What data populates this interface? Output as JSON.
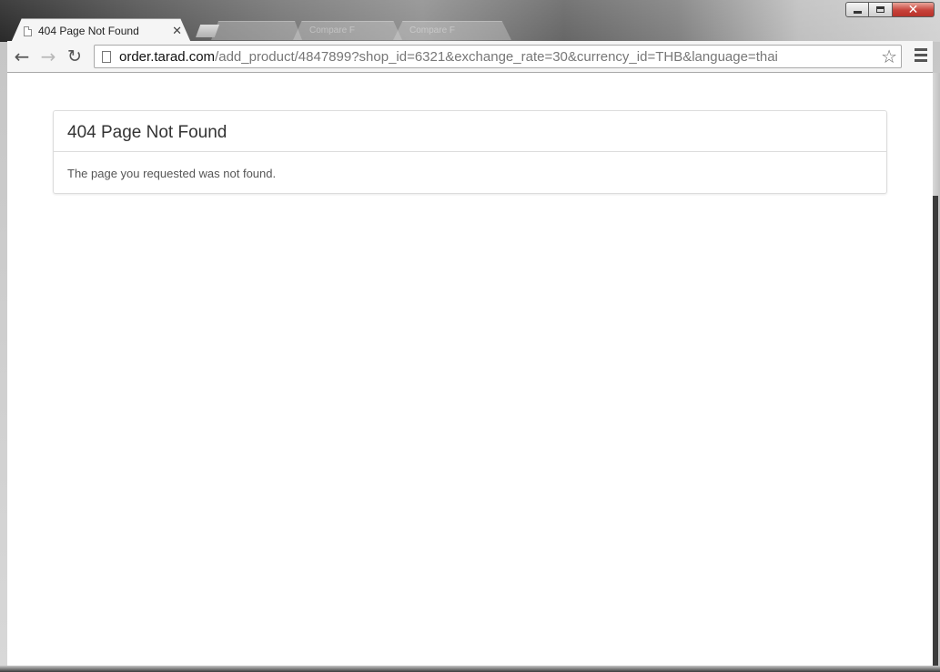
{
  "browser": {
    "active_tab": {
      "title": "404 Page Not Found",
      "close_label": "✕"
    },
    "background_tabs": [
      {
        "title": ""
      },
      {
        "title": "Compare F"
      },
      {
        "title": "Compare F"
      }
    ],
    "address_bar": {
      "url_host": "order.tarad.com",
      "url_rest": "/add_product/4847899?shop_id=6321&exchange_rate=30&currency_id=THB&language=thai"
    },
    "icons": {
      "back": "back-arrow-icon",
      "forward": "forward-arrow-icon",
      "reload": "reload-icon",
      "bookmark": "star-icon",
      "menu": "hamburger-menu-icon"
    }
  },
  "page": {
    "panel_title": "404 Page Not Found",
    "panel_message": "The page you requested was not found."
  }
}
